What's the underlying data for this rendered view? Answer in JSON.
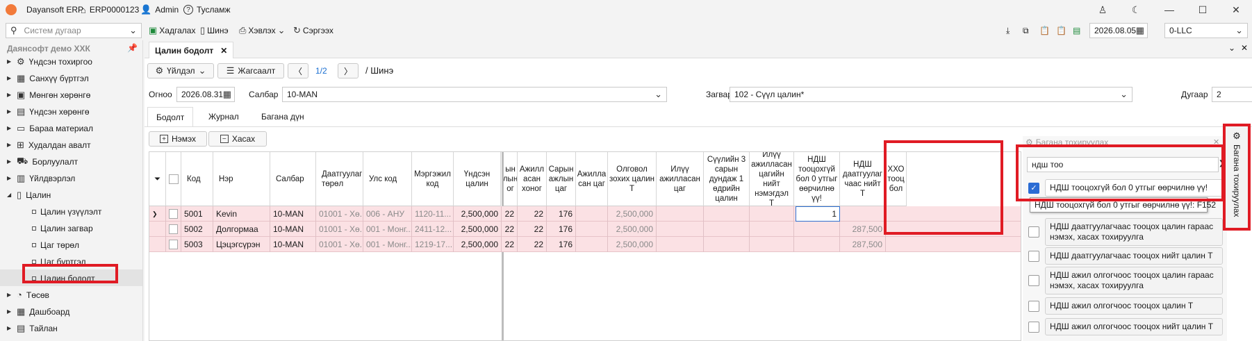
{
  "titlebar": {
    "app": "Dayansoft ERP",
    "record": "ERP0000123",
    "user": "Admin",
    "help": "Тусламж"
  },
  "toolbar": {
    "search_placeholder": "Систем дугаар",
    "save": "Хадгалах",
    "new": "Шинэ",
    "print": "Хэвлэх",
    "refresh": "Сэргээх",
    "date": "2026.08.05",
    "company": "0-LLC"
  },
  "sidebar": {
    "header": "Даянсофт демо ХХК",
    "items": [
      {
        "label": "Үндсэн тохиргоо",
        "icon": "gear-icon"
      },
      {
        "label": "Санхүү бүртгэл",
        "icon": "ledger-icon"
      },
      {
        "label": "Мөнгөн хөрөнгө",
        "icon": "money-icon"
      },
      {
        "label": "Үндсэн хөрөнгө",
        "icon": "asset-icon"
      },
      {
        "label": "Бараа материал",
        "icon": "box-icon"
      },
      {
        "label": "Худалдан авалт",
        "icon": "cart-icon"
      },
      {
        "label": "Борлуулалт",
        "icon": "sales-icon"
      },
      {
        "label": "Үйлдвэрлэл",
        "icon": "factory-icon"
      },
      {
        "label": "Цалин",
        "icon": "salary-icon"
      },
      {
        "label": "Цалин үзүүлэлт"
      },
      {
        "label": "Цалин загвар"
      },
      {
        "label": "Цаг төрөл"
      },
      {
        "label": "Цаг бүртгэл"
      },
      {
        "label": "Цалин бодолт"
      },
      {
        "label": "Төсөв",
        "icon": "budget-icon"
      },
      {
        "label": "Дашбоард",
        "icon": "dashboard-icon"
      },
      {
        "label": "Тайлан",
        "icon": "report-icon"
      }
    ]
  },
  "doc": {
    "tab": "Цалин бодолт",
    "action": "Үйлдэл",
    "list": "Жагсаалт",
    "page": "1/2",
    "mode": "/ Шинэ",
    "date_label": "Огноо",
    "date": "2026.08.31",
    "branch_label": "Салбар",
    "branch": "10-MAN",
    "template_label": "Загвар",
    "template": "102 - Сүүл цалин*",
    "num_label": "Дугаар",
    "num": "2",
    "subtabs": [
      "Бодолт",
      "Журнал",
      "Багана дүн"
    ],
    "add": "Нэмэх",
    "remove": "Хасах"
  },
  "grid": {
    "headers": [
      "Код",
      "Нэр",
      "Салбар",
      "Даатгуулагч төрөл",
      "Улс код",
      "Мэргэжил код",
      "Үндсэн цалин",
      "ын лын ог",
      "Ажилл асан хоног",
      "Сарын ажлын цаг",
      "Ажилла сан цаг",
      "Олговол зохих цалин Т",
      "Илүү ажилласан цаг",
      "Сүүлийн 3 сарын дундаж 1 өдрийн цалин",
      "Илүү ажилласан цагийн нийт нэмэгдэл Т",
      "НДШ тооцохгүй бол 0 утгыг өөрчилнө үү!",
      "НДШ даатгуулаг чаас нийт Т",
      "ХХО тооц бол"
    ],
    "rows": [
      [
        "5001",
        "Kevin",
        "10-MAN",
        "01001 - Хө...",
        "006 - АНУ",
        "1120-11...",
        "2,500,000",
        "22",
        "22",
        "176",
        "",
        "2,500,000",
        "",
        "",
        "",
        "1",
        ""
      ],
      [
        "5002",
        "Долгормаа",
        "10-MAN",
        "01001 - Хө...",
        "001 - Монг...",
        "2411-12...",
        "2,500,000",
        "22",
        "22",
        "176",
        "",
        "2,500,000",
        "",
        "",
        "",
        "",
        "287,500"
      ],
      [
        "5003",
        "Цэцэгсүрэн",
        "10-MAN",
        "01001 - Хө...",
        "001 - Монг...",
        "1219-17...",
        "2,500,000",
        "22",
        "22",
        "176",
        "",
        "2,500,000",
        "",
        "",
        "",
        "",
        "287,500"
      ]
    ]
  },
  "panel": {
    "title": "Багана тохируулах",
    "search": "ндш тоо",
    "items": [
      {
        "label": "НДШ тооцохгүй бол 0 утгыг өөрчилнө үү!",
        "checked": true
      },
      {
        "label": "НДШ даатгуулагчаас тооцох цалин гараас нэмэх, хасах тохируулга",
        "checked": false
      },
      {
        "label": "НДШ даатгуулагчаас тооцох нийт цалин Т",
        "checked": false
      },
      {
        "label": "НДШ ажил олгогчоос тооцох цалин гараас нэмэх, хасах тохируулга",
        "checked": false
      },
      {
        "label": "НДШ ажил олгогчоос тооцох цалин Т",
        "checked": false
      },
      {
        "label": "НДШ ажил олгогчоос тооцох нийт цалин Т",
        "checked": false
      }
    ],
    "tooltip": "НДШ тооцохгүй бол 0 утгыг өөрчилнө үү!: F152"
  },
  "vtab": "Багана тохируулах"
}
